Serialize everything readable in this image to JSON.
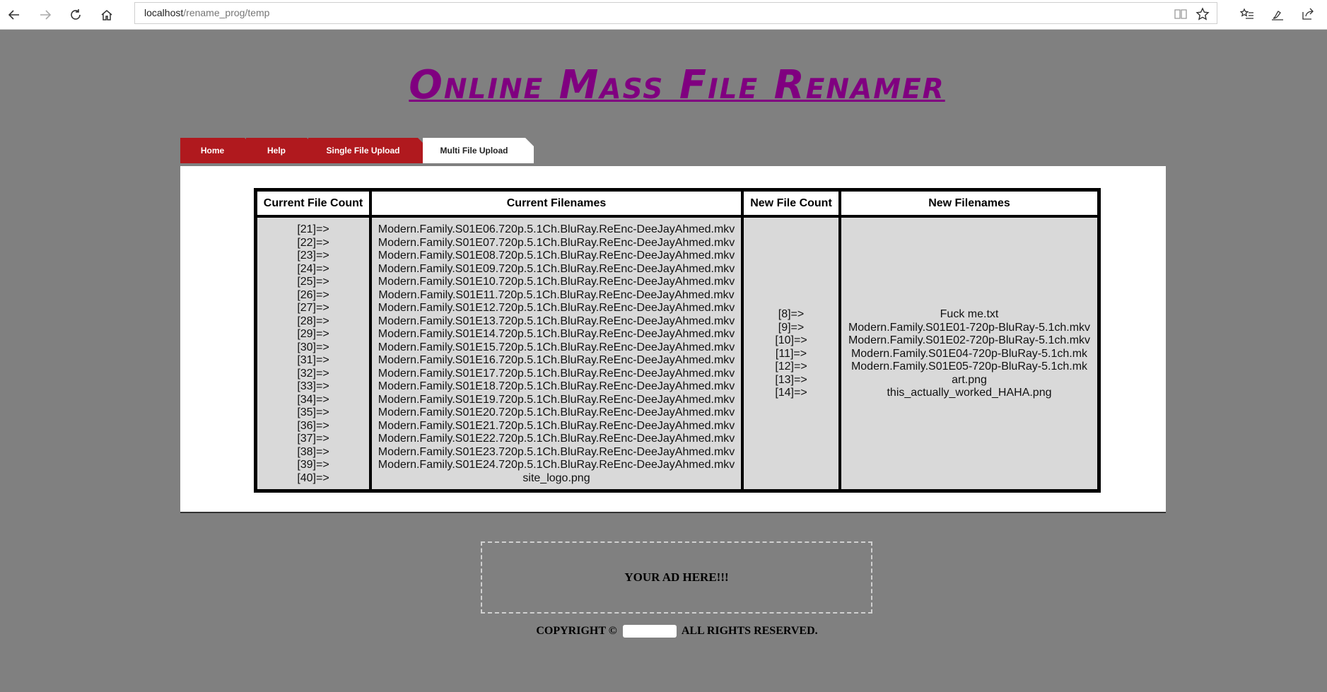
{
  "browser": {
    "url_host": "localhost",
    "url_path": "/rename_prog/temp"
  },
  "site": {
    "title": "Online Mass File Renamer"
  },
  "tabs": [
    {
      "label": "Home"
    },
    {
      "label": "Help"
    },
    {
      "label": "Single File Upload"
    },
    {
      "label": "Multi File Upload"
    }
  ],
  "table": {
    "headers": [
      "Current File Count",
      "Current Filenames",
      "New File Count",
      "New Filenames"
    ],
    "current_counts": [
      "[21]=>",
      "[22]=>",
      "[23]=>",
      "[24]=>",
      "[25]=>",
      "[26]=>",
      "[27]=>",
      "[28]=>",
      "[29]=>",
      "[30]=>",
      "[31]=>",
      "[32]=>",
      "[33]=>",
      "[34]=>",
      "[35]=>",
      "[36]=>",
      "[37]=>",
      "[38]=>",
      "[39]=>",
      "[40]=>"
    ],
    "current_filenames": [
      "Modern.Family.S01E06.720p.5.1Ch.BluRay.ReEnc-DeeJayAhmed.mkv",
      "Modern.Family.S01E07.720p.5.1Ch.BluRay.ReEnc-DeeJayAhmed.mkv",
      "Modern.Family.S01E08.720p.5.1Ch.BluRay.ReEnc-DeeJayAhmed.mkv",
      "Modern.Family.S01E09.720p.5.1Ch.BluRay.ReEnc-DeeJayAhmed.mkv",
      "Modern.Family.S01E10.720p.5.1Ch.BluRay.ReEnc-DeeJayAhmed.mkv",
      "Modern.Family.S01E11.720p.5.1Ch.BluRay.ReEnc-DeeJayAhmed.mkv",
      "Modern.Family.S01E12.720p.5.1Ch.BluRay.ReEnc-DeeJayAhmed.mkv",
      "Modern.Family.S01E13.720p.5.1Ch.BluRay.ReEnc-DeeJayAhmed.mkv",
      "Modern.Family.S01E14.720p.5.1Ch.BluRay.ReEnc-DeeJayAhmed.mkv",
      "Modern.Family.S01E15.720p.5.1Ch.BluRay.ReEnc-DeeJayAhmed.mkv",
      "Modern.Family.S01E16.720p.5.1Ch.BluRay.ReEnc-DeeJayAhmed.mkv",
      "Modern.Family.S01E17.720p.5.1Ch.BluRay.ReEnc-DeeJayAhmed.mkv",
      "Modern.Family.S01E18.720p.5.1Ch.BluRay.ReEnc-DeeJayAhmed.mkv",
      "Modern.Family.S01E19.720p.5.1Ch.BluRay.ReEnc-DeeJayAhmed.mkv",
      "Modern.Family.S01E20.720p.5.1Ch.BluRay.ReEnc-DeeJayAhmed.mkv",
      "Modern.Family.S01E21.720p.5.1Ch.BluRay.ReEnc-DeeJayAhmed.mkv",
      "Modern.Family.S01E22.720p.5.1Ch.BluRay.ReEnc-DeeJayAhmed.mkv",
      "Modern.Family.S01E23.720p.5.1Ch.BluRay.ReEnc-DeeJayAhmed.mkv",
      "Modern.Family.S01E24.720p.5.1Ch.BluRay.ReEnc-DeeJayAhmed.mkv",
      "site_logo.png"
    ],
    "new_counts": [
      "[8]=>",
      "[9]=>",
      "[10]=>",
      "[11]=>",
      "[12]=>",
      "[13]=>",
      "[14]=>"
    ],
    "new_filenames": [
      "Fuck me.txt",
      "Modern.Family.S01E01-720p-BluRay-5.1ch.mkv",
      "Modern.Family.S01E02-720p-BluRay-5.1ch.mkv",
      "Modern.Family.S01E04-720p-BluRay-5.1ch.mk",
      "Modern.Family.S01E05-720p-BluRay-5.1ch.mk",
      "art.png",
      "this_actually_worked_HAHA.png"
    ]
  },
  "ad": {
    "text": "YOUR AD HERE!!!"
  },
  "footer": {
    "prefix": "COPYRIGHT ©",
    "suffix": "ALL RIGHTS RESERVED."
  },
  "colors": {
    "background": "#808080",
    "title": "#800080",
    "tab": "#b0191e",
    "cell": "#d9d9d9"
  }
}
